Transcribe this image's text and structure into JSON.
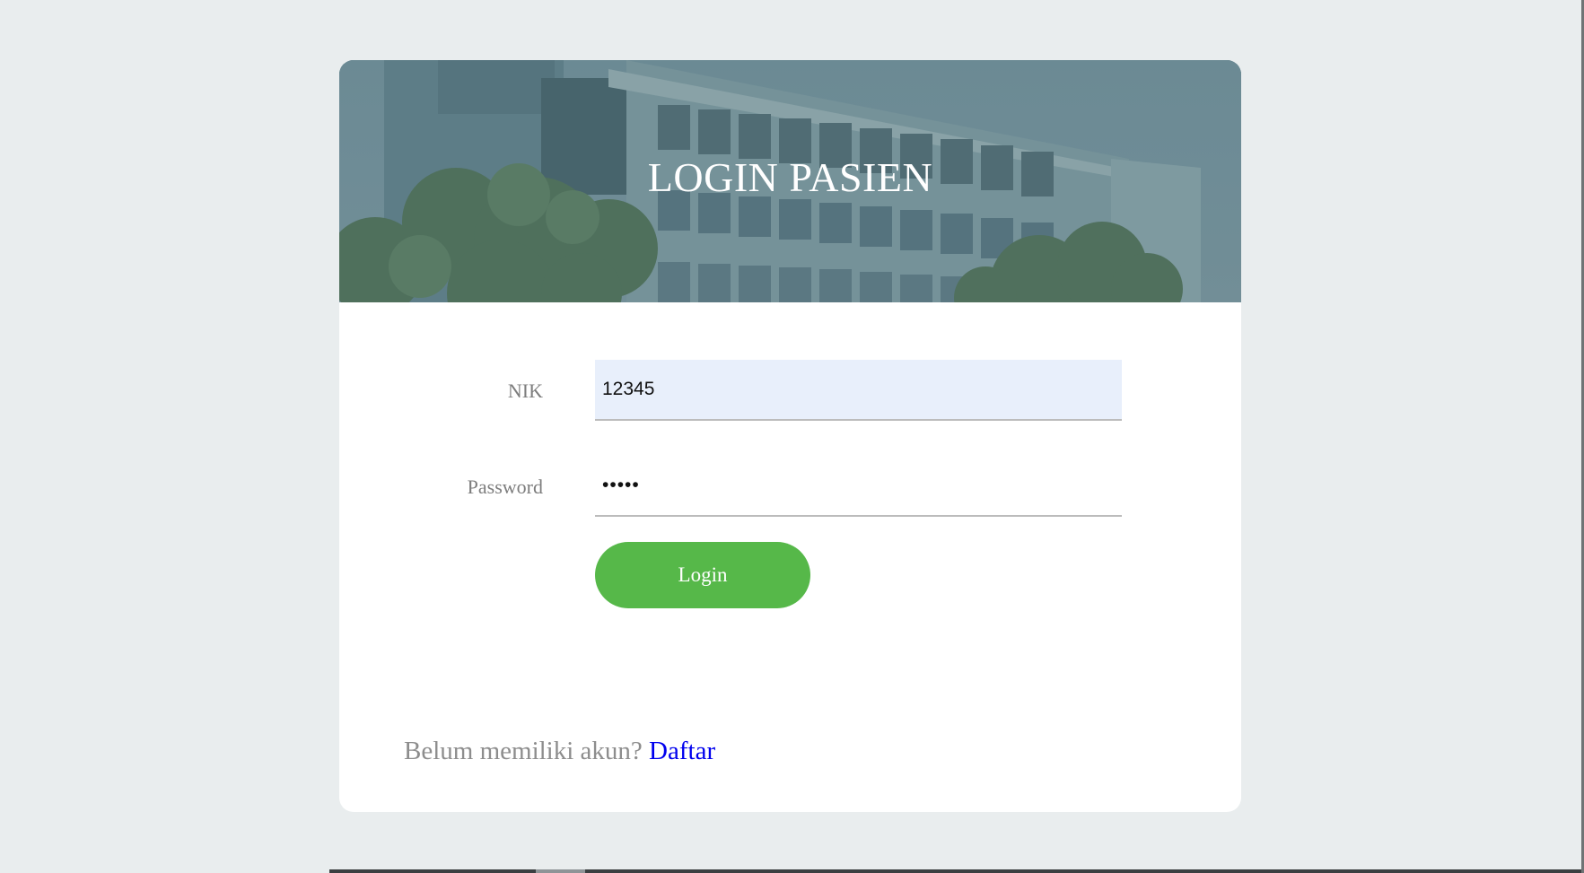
{
  "header": {
    "title": "LOGIN PASIEN"
  },
  "form": {
    "nik": {
      "label": "NIK",
      "value": "12345"
    },
    "password": {
      "label": "Password",
      "value": "12345"
    },
    "login_label": "Login"
  },
  "footer": {
    "prompt": "Belum memiliki akun?",
    "link_label": "Daftar"
  },
  "colors": {
    "page_background": "#e9edee",
    "card_background": "#ffffff",
    "hero_overlay": "#5e7f88",
    "nik_field_background": "#e8effb",
    "login_button": "#56b849",
    "link": "#0000ee",
    "label_text": "#7d7d7d"
  }
}
